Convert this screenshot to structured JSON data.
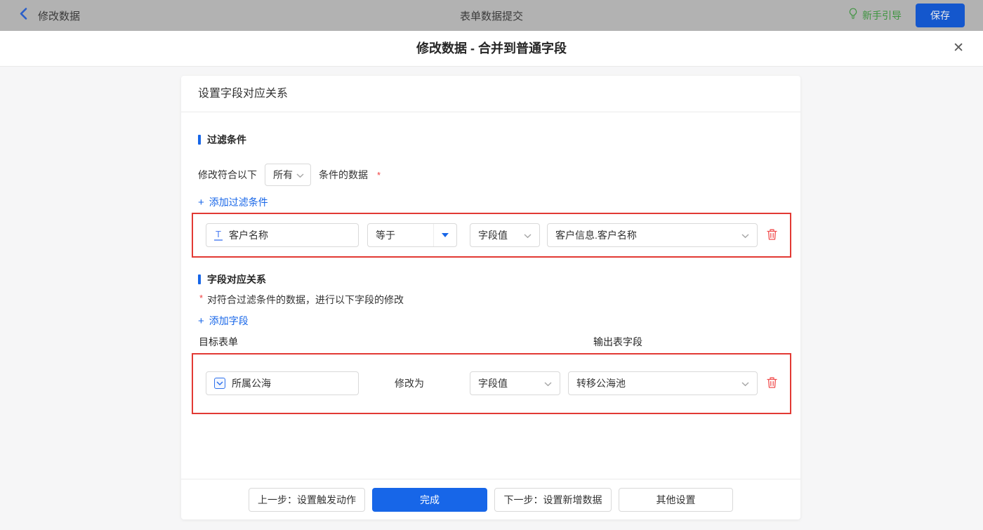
{
  "topbar": {
    "back_label": "修改数据",
    "title": "表单数据提交",
    "guide_label": "新手引导",
    "save_label": "保存"
  },
  "modal": {
    "title": "修改数据 - 合并到普通字段"
  },
  "icons": {
    "plus": "+",
    "close": "✕",
    "text_field": "T"
  },
  "colors": {
    "accent_blue": "#1766e8",
    "danger_red": "#f14f4f",
    "highlight_border": "#e23a34",
    "guide_green": "#3f9440",
    "save_button_blue": "#1457cd"
  },
  "card": {
    "header": "设置字段对应关系",
    "filter": {
      "section_title": "过滤条件",
      "cond_prefix": "修改符合以下",
      "cond_select_value": "所有",
      "cond_suffix": "条件的数据",
      "required_mark": "*",
      "add_link_label": "添加过滤条件",
      "row": {
        "field": "客户名称",
        "operator": "等于",
        "value_type": "字段值",
        "value": "客户信息.客户名称"
      }
    },
    "mapping": {
      "section_title": "字段对应关系",
      "required_mark": "*",
      "note": "对符合过滤条件的数据，进行以下字段的修改",
      "add_link_label": "添加字段",
      "col_target_form": "目标表单",
      "col_output_field": "输出表字段",
      "row": {
        "field": "所属公海",
        "modify_label": "修改为",
        "value_type": "字段值",
        "value": "转移公海池"
      }
    },
    "footer": {
      "prev": "上一步：设置触发动作",
      "done": "完成",
      "next": "下一步：设置新增数据",
      "other": "其他设置"
    }
  }
}
